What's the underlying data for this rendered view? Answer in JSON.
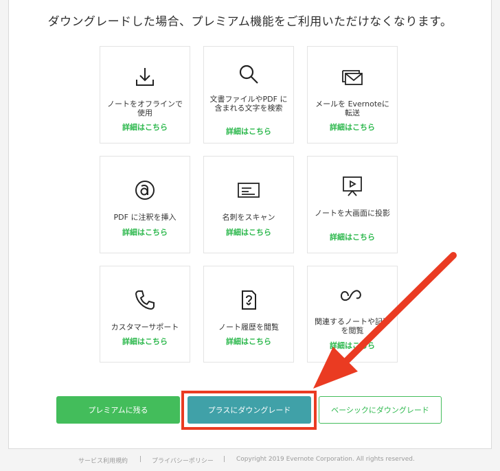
{
  "headline": "ダウングレードした場合、プレミアム機能をご利用いただけなくなります。",
  "feature_cards": [
    {
      "label": "ノートをオフラインで使用",
      "icon": "download-icon",
      "more": "詳細はこちら"
    },
    {
      "label": "文書ファイルやPDF に含まれる文字を検索",
      "icon": "search-icon",
      "more": "詳細はこちら"
    },
    {
      "label": "メールを Evernoteに転送",
      "icon": "email-forward-icon",
      "more": "詳細はこちら"
    },
    {
      "label": "PDF に注釈を挿入",
      "icon": "annotate-icon",
      "more": "詳細はこちら"
    },
    {
      "label": "名刺をスキャン",
      "icon": "business-card-icon",
      "more": "詳細はこちら"
    },
    {
      "label": "ノートを大画面に投影",
      "icon": "present-icon",
      "more": "詳細はこちら"
    },
    {
      "label": "カスタマーサポート",
      "icon": "phone-icon",
      "more": "詳細はこちら"
    },
    {
      "label": "ノート履歴を閲覧",
      "icon": "note-history-icon",
      "more": "詳細はこちら"
    },
    {
      "label": "関連するノートや記事を閲覧",
      "icon": "related-context-icon",
      "more": "詳細はこちら"
    }
  ],
  "buttons": {
    "stay_premium": "プレミアムに残る",
    "downgrade_plus": "プラスにダウングレード",
    "downgrade_basic": "ベーシックにダウングレード"
  },
  "footer": {
    "terms": "サービス利用規約",
    "privacy": "プライバシーポリシー",
    "copyright": "Copyright 2019 Evernote Corporation. All rights reserved.",
    "separator": "|"
  },
  "colors": {
    "green": "#43bd5b",
    "teal": "#40a1a8",
    "link_green": "#2db84d",
    "highlight_red": "#ea3b22"
  }
}
